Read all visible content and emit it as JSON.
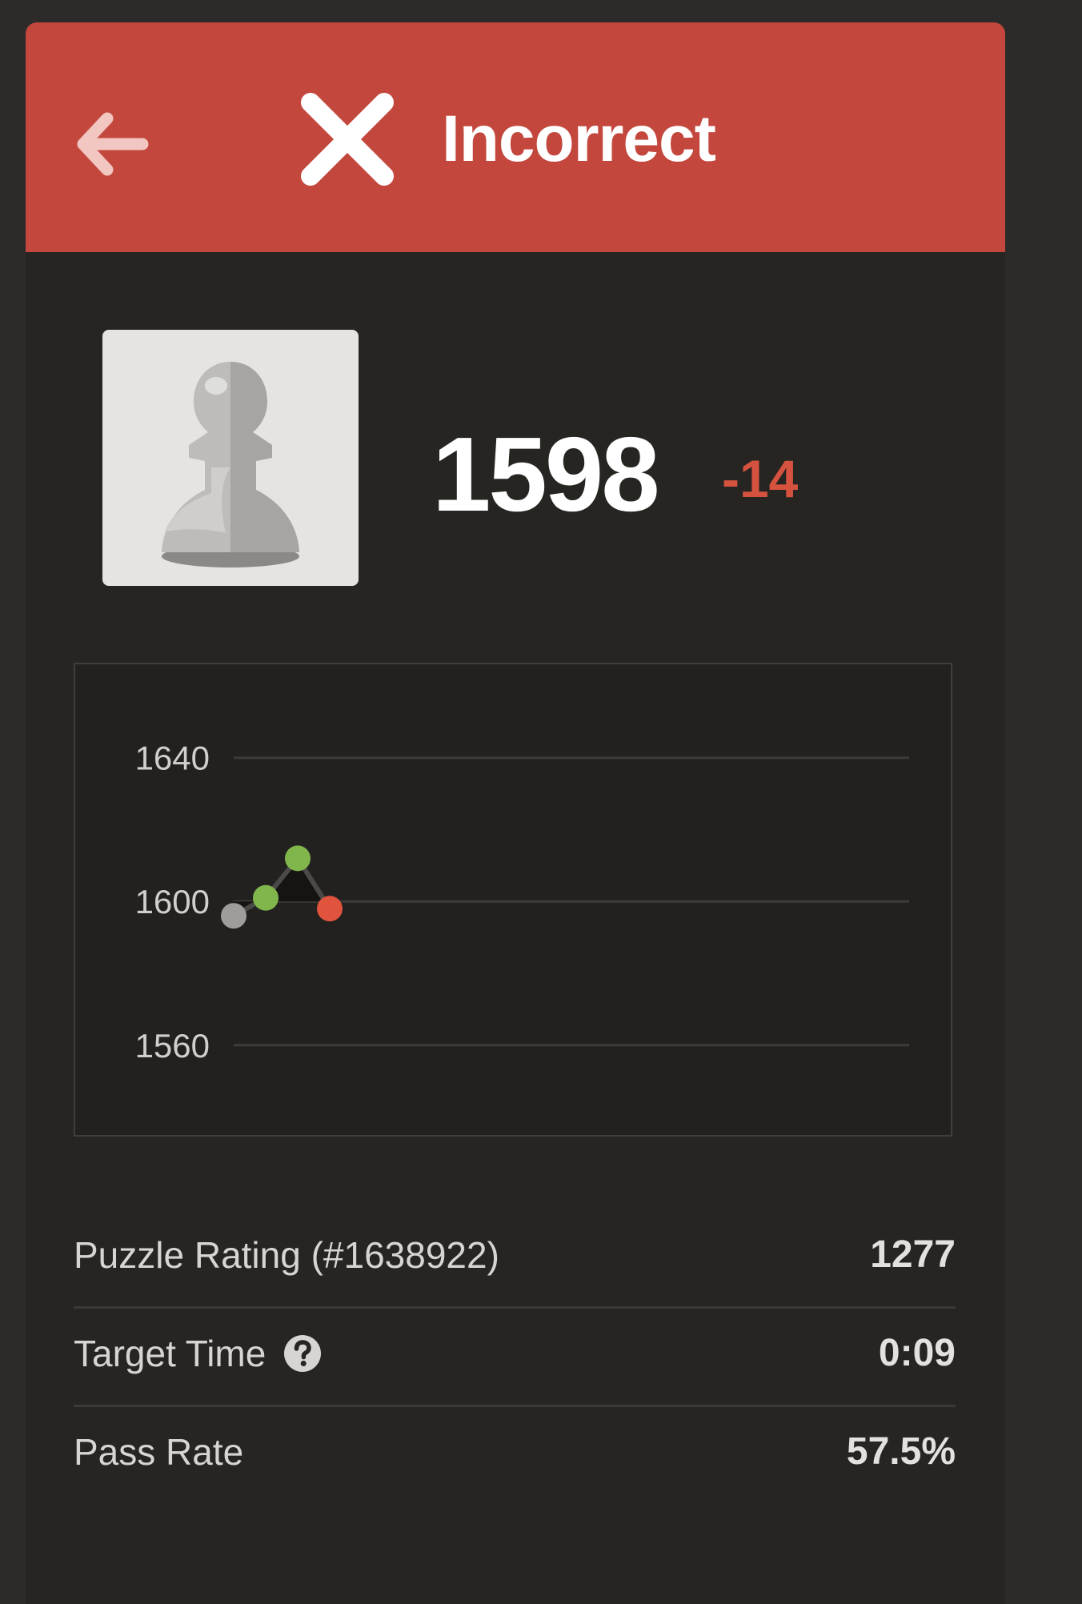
{
  "header": {
    "status_title": "Incorrect",
    "back_icon": "arrow-left-icon",
    "status_icon": "x-mark-icon",
    "color": "#c3473c"
  },
  "player": {
    "avatar_icon": "pawn-icon",
    "rating": "1598",
    "rating_change": "-14",
    "rating_change_color": "#d4523e"
  },
  "chart_data": {
    "type": "line",
    "y_ticks": [
      "1640",
      "1600",
      "1560"
    ],
    "ylim": [
      1535,
      1666
    ],
    "x": [
      1,
      2,
      3,
      4
    ],
    "points": [
      {
        "x": 1,
        "y": 1596,
        "status": "start",
        "color": "#9e9d9b"
      },
      {
        "x": 2,
        "y": 1601,
        "status": "correct",
        "color": "#81b64c"
      },
      {
        "x": 3,
        "y": 1612,
        "status": "correct",
        "color": "#81b64c"
      },
      {
        "x": 4,
        "y": 1598,
        "status": "incorrect",
        "color": "#e0533d"
      }
    ],
    "grid": true
  },
  "stats": {
    "puzzle_rating_label": "Puzzle Rating (#1638922)",
    "puzzle_rating_value": "1277",
    "target_time_label": "Target Time",
    "target_time_value": "0:09",
    "pass_rate_label": "Pass Rate",
    "pass_rate_value": "57.5%",
    "help_icon": "question-circle-icon"
  }
}
